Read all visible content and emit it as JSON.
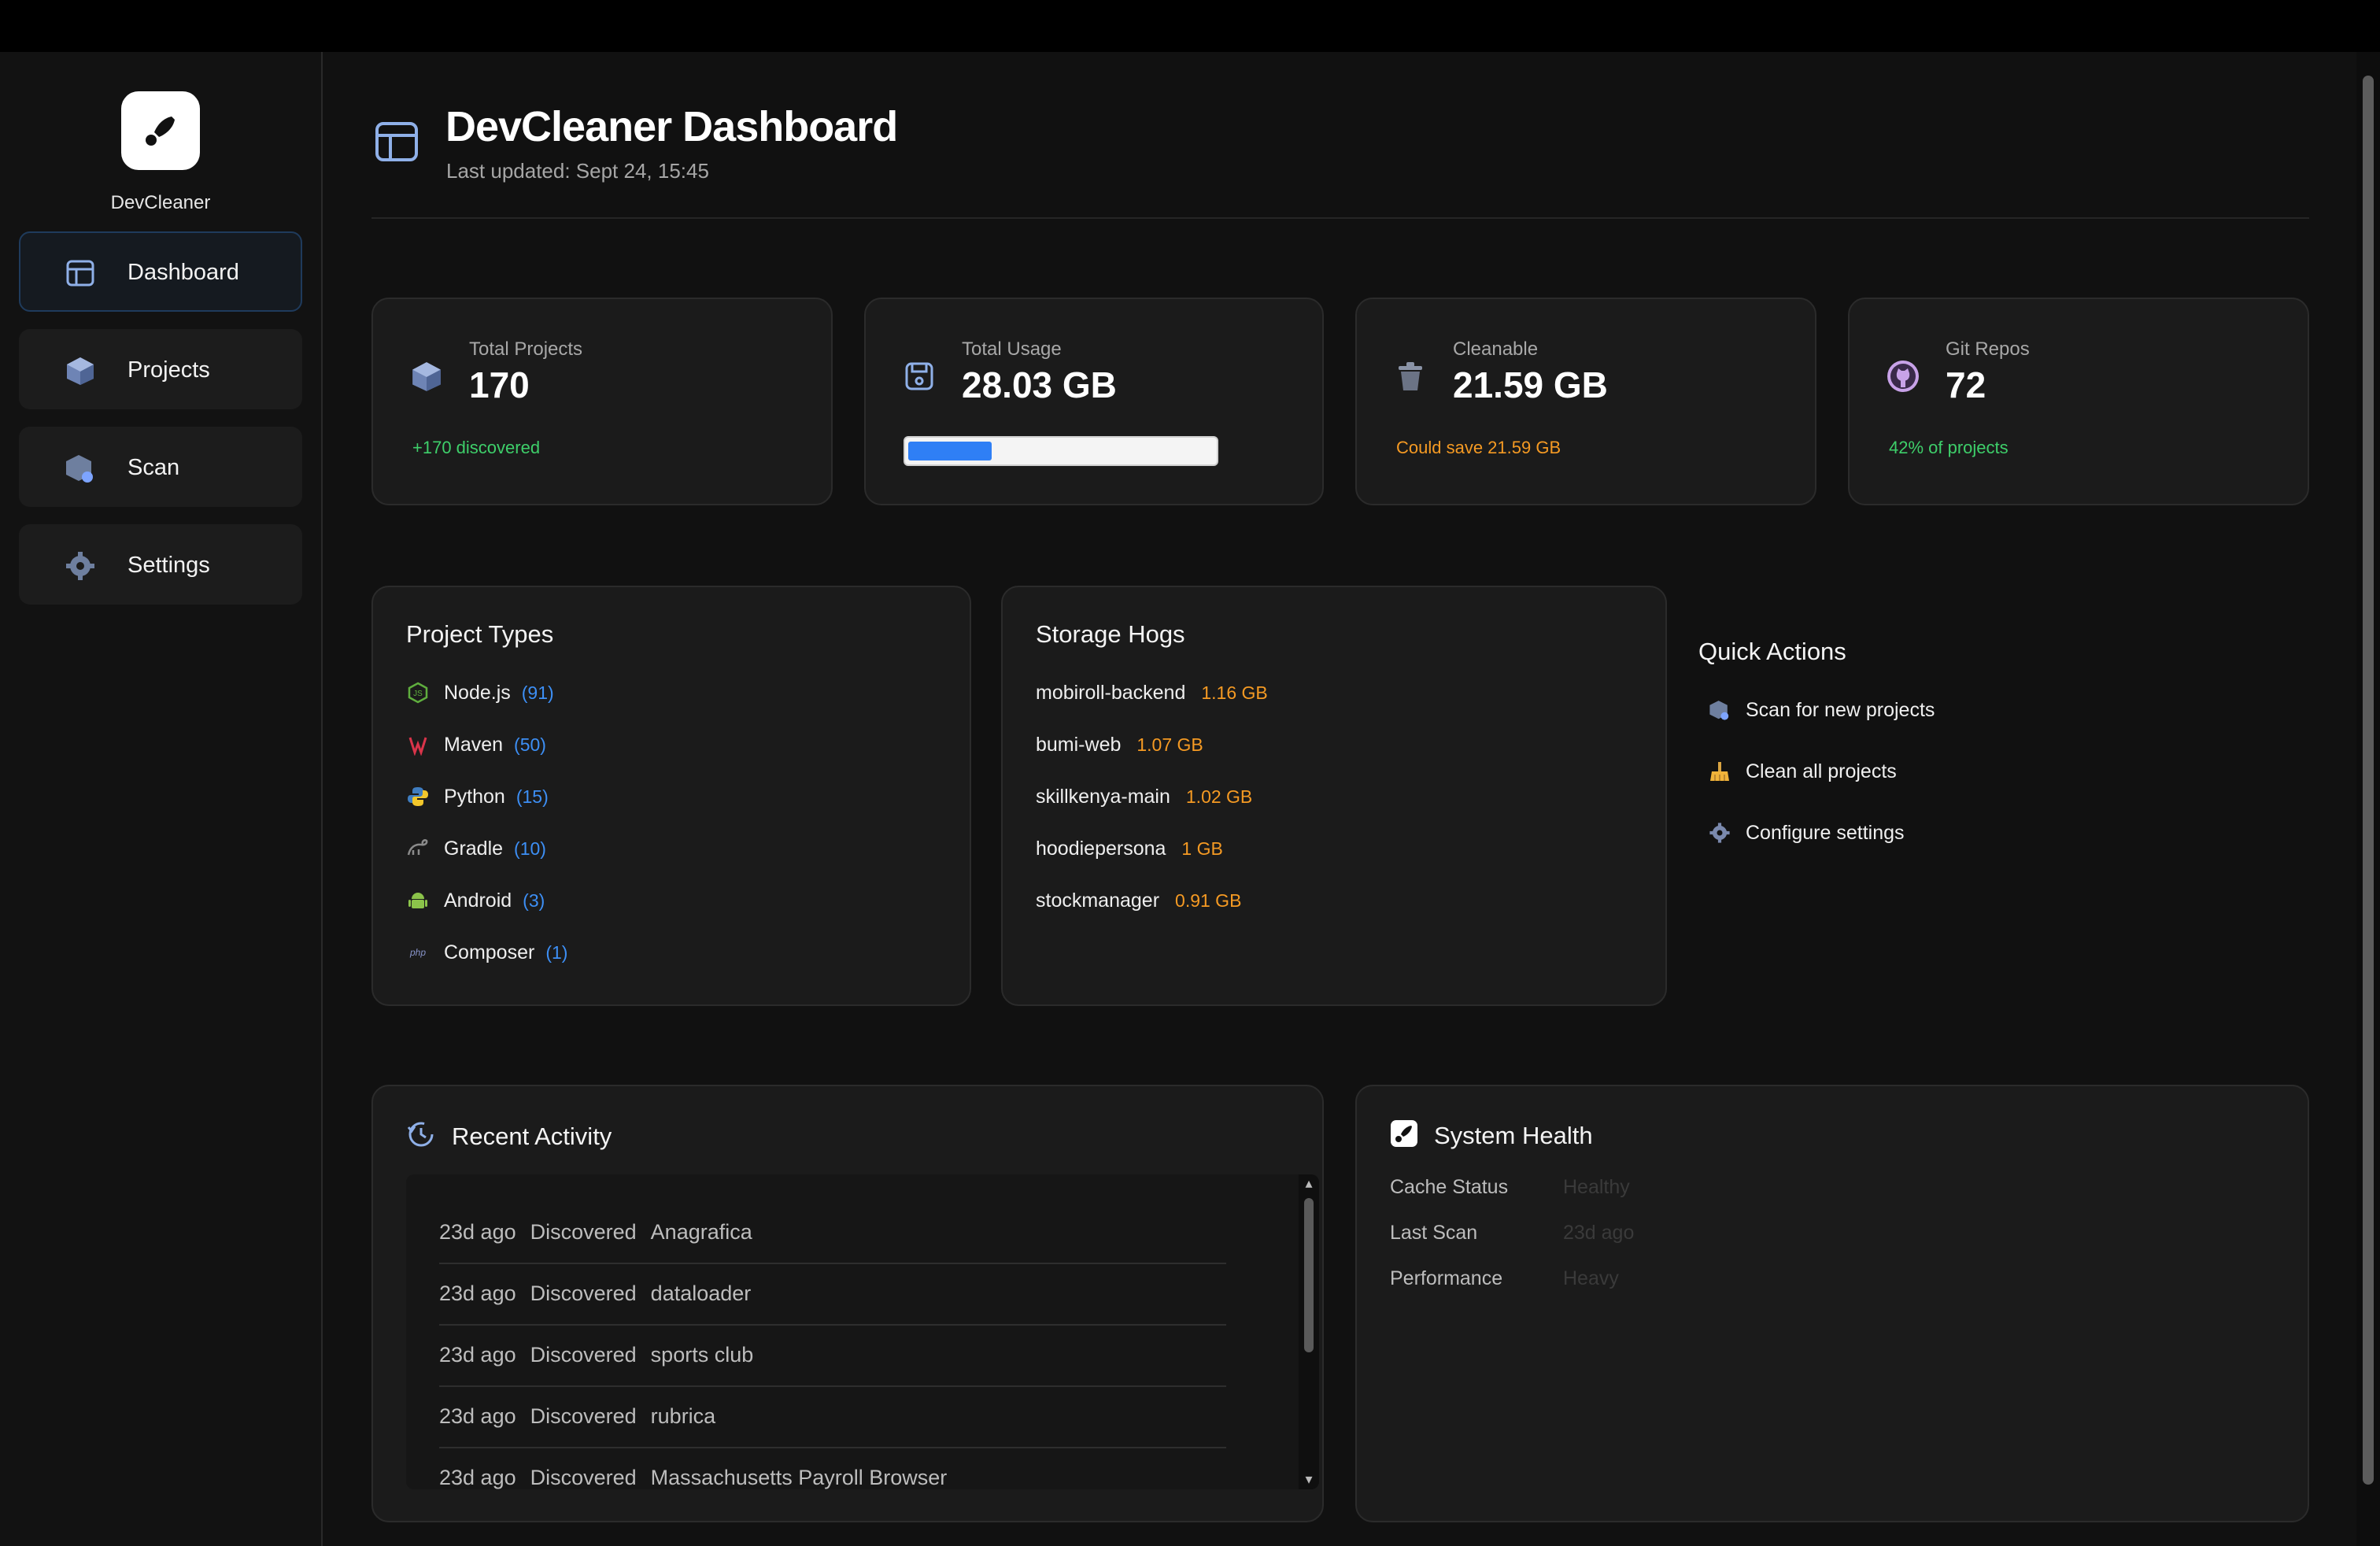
{
  "app": {
    "name": "DevCleaner"
  },
  "nav": [
    {
      "label": "Dashboard",
      "icon": "layout-icon",
      "active": true
    },
    {
      "label": "Projects",
      "icon": "cube-icon"
    },
    {
      "label": "Scan",
      "icon": "scan-icon"
    },
    {
      "label": "Settings",
      "icon": "gear-icon"
    }
  ],
  "header": {
    "title": "DevCleaner Dashboard",
    "subtitle": "Last updated: Sept 24, 15:45"
  },
  "stats": [
    {
      "label": "Total Projects",
      "value": "170",
      "sub": "+170 discovered",
      "sub_color": "#3ecf6a",
      "icon": "cube-icon"
    },
    {
      "label": "Total Usage",
      "value": "28.03 GB",
      "progress": 0.27,
      "icon": "disk-icon"
    },
    {
      "label": "Cleanable",
      "value": "21.59 GB",
      "sub": "Could save 21.59 GB",
      "sub_color": "#f59a23",
      "icon": "trash-icon"
    },
    {
      "label": "Git Repos",
      "value": "72",
      "sub": "42% of projects",
      "sub_color": "#3ecf6a",
      "icon": "github-icon"
    }
  ],
  "project_types": {
    "title": "Project Types",
    "items": [
      {
        "name": "Node.js",
        "count": "(91)",
        "icon": "nodejs-icon"
      },
      {
        "name": "Maven",
        "count": "(50)",
        "icon": "maven-icon"
      },
      {
        "name": "Python",
        "count": "(15)",
        "icon": "python-icon"
      },
      {
        "name": "Gradle",
        "count": "(10)",
        "icon": "gradle-icon"
      },
      {
        "name": "Android",
        "count": "(3)",
        "icon": "android-icon"
      },
      {
        "name": "Composer",
        "count": "(1)",
        "icon": "php-icon"
      }
    ]
  },
  "storage_hogs": {
    "title": "Storage Hogs",
    "items": [
      {
        "name": "mobiroll-backend",
        "size": "1.16 GB"
      },
      {
        "name": "bumi-web",
        "size": "1.07 GB"
      },
      {
        "name": "skillkenya-main",
        "size": "1.02 GB"
      },
      {
        "name": "hoodiepersona",
        "size": "1 GB"
      },
      {
        "name": "stockmanager",
        "size": "0.91 GB"
      }
    ]
  },
  "quick_actions": {
    "title": "Quick Actions",
    "items": [
      {
        "label": "Scan for new projects",
        "icon": "scan-icon"
      },
      {
        "label": "Clean all projects",
        "icon": "broom-icon"
      },
      {
        "label": "Configure settings",
        "icon": "gear-icon"
      }
    ]
  },
  "recent_activity": {
    "title": "Recent Activity",
    "items": [
      {
        "time": "23d ago",
        "action": "Discovered",
        "target": "Anagrafica"
      },
      {
        "time": "23d ago",
        "action": "Discovered",
        "target": "dataloader"
      },
      {
        "time": "23d ago",
        "action": "Discovered",
        "target": "sports club"
      },
      {
        "time": "23d ago",
        "action": "Discovered",
        "target": "rubrica"
      },
      {
        "time": "23d ago",
        "action": "Discovered",
        "target": "Massachusetts Payroll Browser"
      }
    ]
  },
  "system_health": {
    "title": "System Health",
    "rows": [
      {
        "label": "Cache Status",
        "value": "Healthy"
      },
      {
        "label": "Last Scan",
        "value": "23d ago"
      },
      {
        "label": "Performance",
        "value": "Heavy"
      }
    ]
  },
  "colors": {
    "accent": "#2f7ff5",
    "green": "#3ecf6a",
    "orange": "#f59a23",
    "count_blue": "#3d8ff5"
  }
}
